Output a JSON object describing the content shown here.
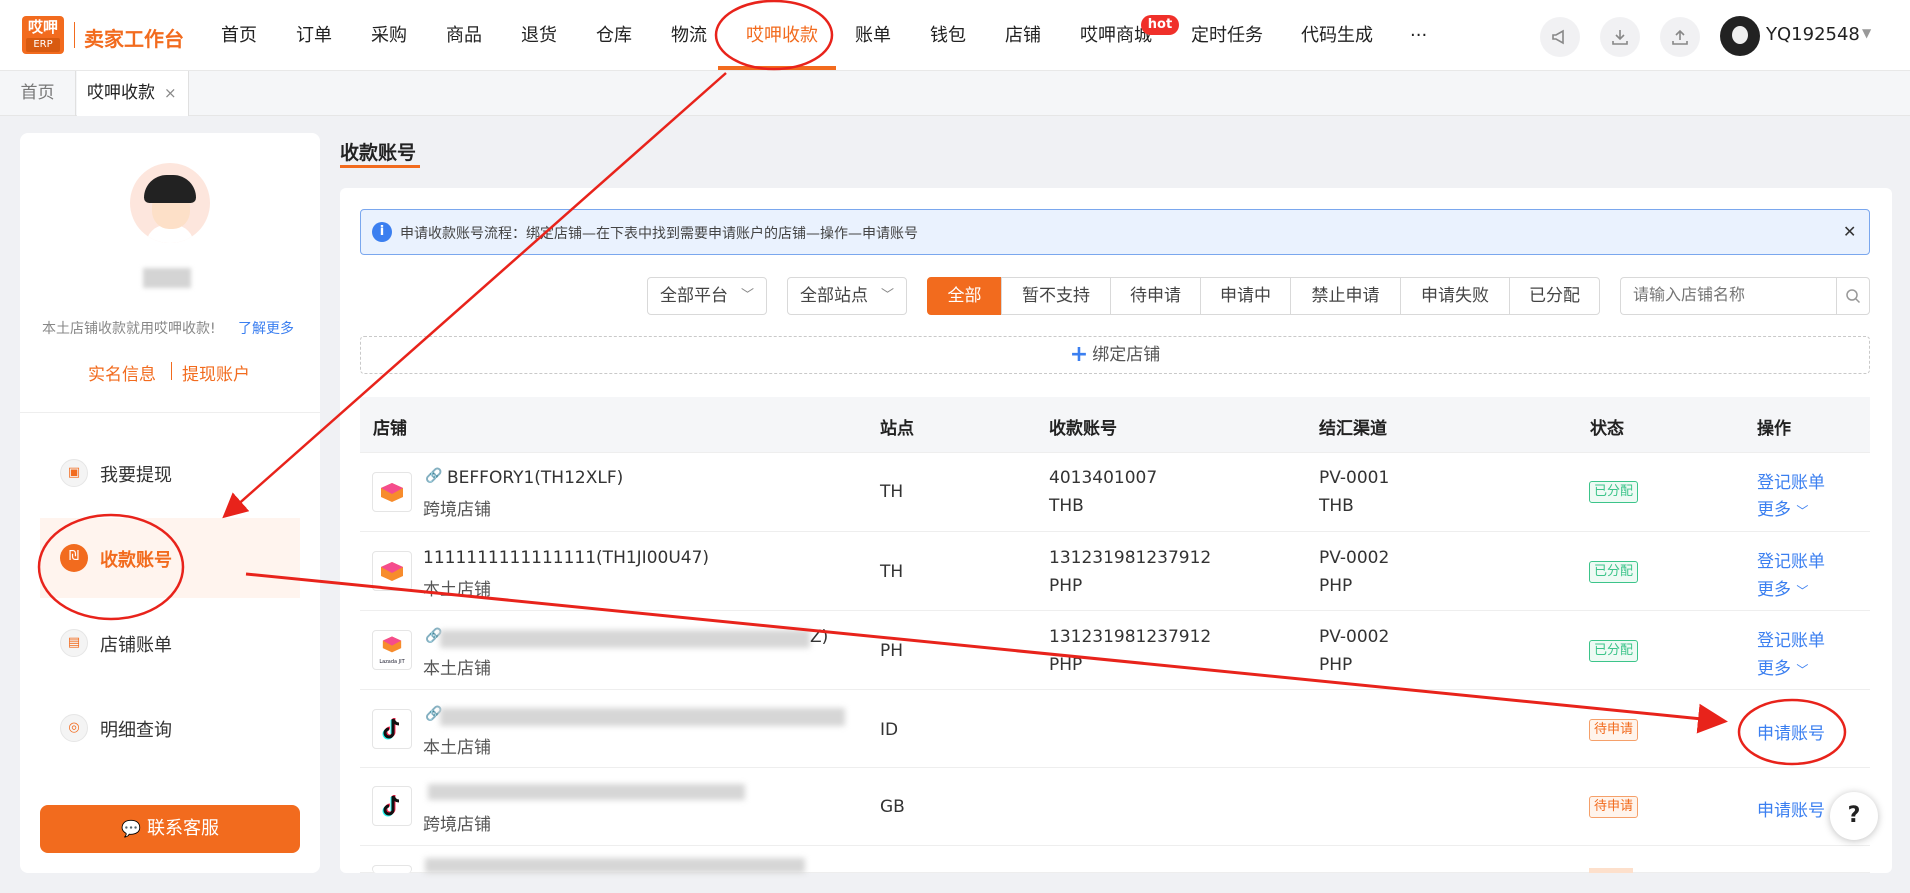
{
  "app": {
    "logo_top": "哎呷",
    "logo_bottom": "ERP",
    "brand": "卖家工作台"
  },
  "nav": {
    "items": [
      "首页",
      "订单",
      "采购",
      "商品",
      "退货",
      "仓库",
      "物流",
      "哎呷收款",
      "账单",
      "钱包",
      "店铺",
      "哎呷商城",
      "定时任务",
      "代码生成",
      "···"
    ],
    "active": "哎呷收款",
    "hot_badge": "hot",
    "username": "YQ192548"
  },
  "tabs": {
    "home": "首页",
    "current": "哎呷收款",
    "close": "×"
  },
  "sidebar": {
    "intro": "本土店铺收款就用哎呷收款!",
    "learn_more": "了解更多",
    "realname": "实名信息",
    "withdraw_account": "提现账户",
    "menu": [
      {
        "label": "我要提现",
        "icon": "withdraw-icon"
      },
      {
        "label": "收款账号",
        "icon": "account-icon"
      },
      {
        "label": "店铺账单",
        "icon": "bill-icon"
      },
      {
        "label": "明细查询",
        "icon": "search-doc-icon"
      }
    ],
    "contact": "联系客服"
  },
  "main": {
    "title": "收款账号",
    "notice": "申请收款账号流程：绑定店铺—在下表中找到需要申请账户的店铺—操作—申请账号",
    "filters": {
      "platform": "全部平台",
      "site": "全部站点",
      "status": [
        "全部",
        "暂不支持",
        "待申请",
        "申请中",
        "禁止申请",
        "申请失败",
        "已分配"
      ],
      "active_status": "全部"
    },
    "search_placeholder": "请输入店铺名称",
    "bind_store": "绑定店铺"
  },
  "table": {
    "headers": [
      "店铺",
      "站点",
      "收款账号",
      "结汇渠道",
      "状态",
      "操作"
    ],
    "rows": [
      {
        "store": "BEFFORY1(TH12XLF)",
        "type": "跨境店铺",
        "site": "TH",
        "account": "4013401007",
        "account_currency": "THB",
        "channel": "PV-0001",
        "channel_currency": "THB",
        "status": "已分配",
        "op1": "登记账单",
        "op2": "更多"
      },
      {
        "store": "1111111111111111(TH1JI00U47)",
        "type": "本土店铺",
        "site": "TH",
        "account": "131231981237912",
        "account_currency": "PHP",
        "channel": "PV-0002",
        "channel_currency": "PHP",
        "status": "已分配",
        "op1": "登记账单",
        "op2": "更多"
      },
      {
        "store_suffix": "Z)",
        "type": "本土店铺",
        "site": "PH",
        "account": "131231981237912",
        "account_currency": "PHP",
        "channel": "PV-0002",
        "channel_currency": "PHP",
        "status": "已分配",
        "op1": "登记账单",
        "op2": "更多",
        "logo_text": "Lazada JIT"
      },
      {
        "type": "本土店铺",
        "site": "ID",
        "status": "待申请",
        "op1": "申请账号"
      },
      {
        "type": "跨境店铺",
        "site": "GB",
        "status": "待申请",
        "op1": "申请账号"
      }
    ]
  },
  "help": "?",
  "colors": {
    "accent": "#f26b1e",
    "link": "#3b7ff0",
    "annotation": "#e8231b"
  }
}
